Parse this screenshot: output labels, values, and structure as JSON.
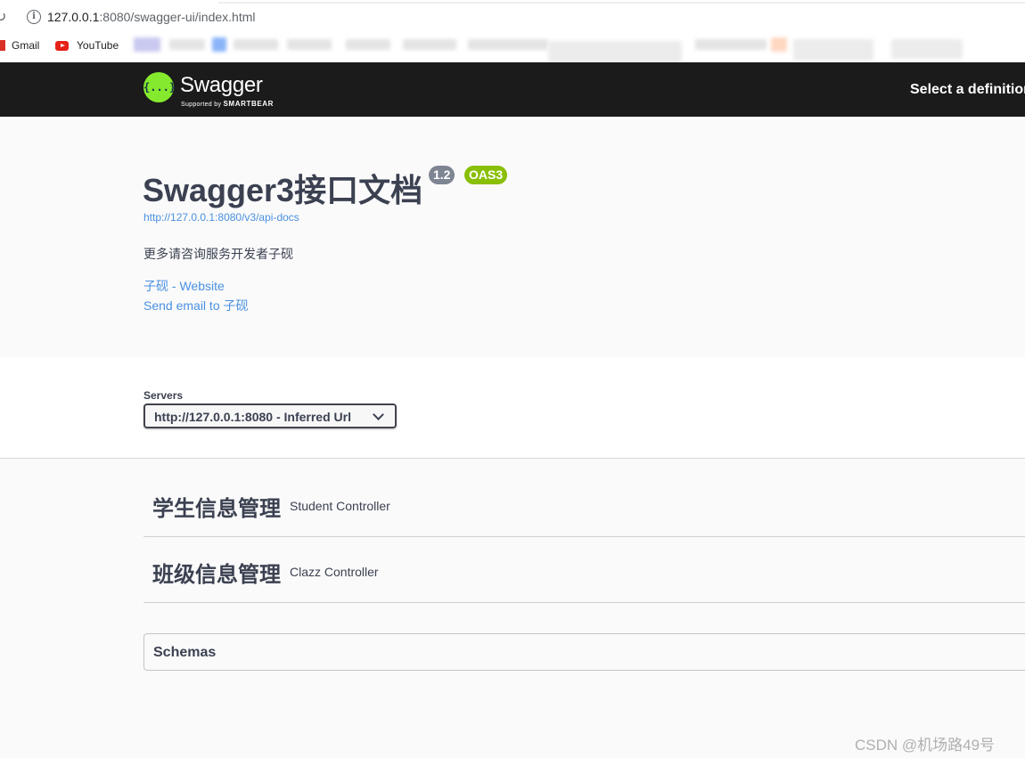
{
  "browser": {
    "url_host": "127.0.0.1",
    "url_rest": ":8080/swagger-ui/index.html",
    "bookmarks": [
      {
        "label": "Gmail"
      },
      {
        "label": "YouTube"
      }
    ]
  },
  "topbar": {
    "logo_mark": "{...}",
    "logo_text": "Swagger",
    "logo_sub_prefix": "Supported by",
    "logo_sub_brand": "SMARTBEAR",
    "select_definition": "Select a definition"
  },
  "info": {
    "title": "Swagger3接口文档",
    "version": "1.2",
    "oas": "OAS3",
    "api_docs_url": "http://127.0.0.1:8080/v3/api-docs",
    "description": "更多请咨询服务开发者子砚",
    "contact_website": "子砚 - Website",
    "contact_email": "Send email to 子砚"
  },
  "servers": {
    "label": "Servers",
    "selected": "http://127.0.0.1:8080 - Inferred Url"
  },
  "tags": [
    {
      "name": "学生信息管理",
      "description": "Student Controller"
    },
    {
      "name": "班级信息管理",
      "description": "Clazz Controller"
    }
  ],
  "schemas": {
    "title": "Schemas"
  },
  "watermark": "CSDN @机场路49号"
}
